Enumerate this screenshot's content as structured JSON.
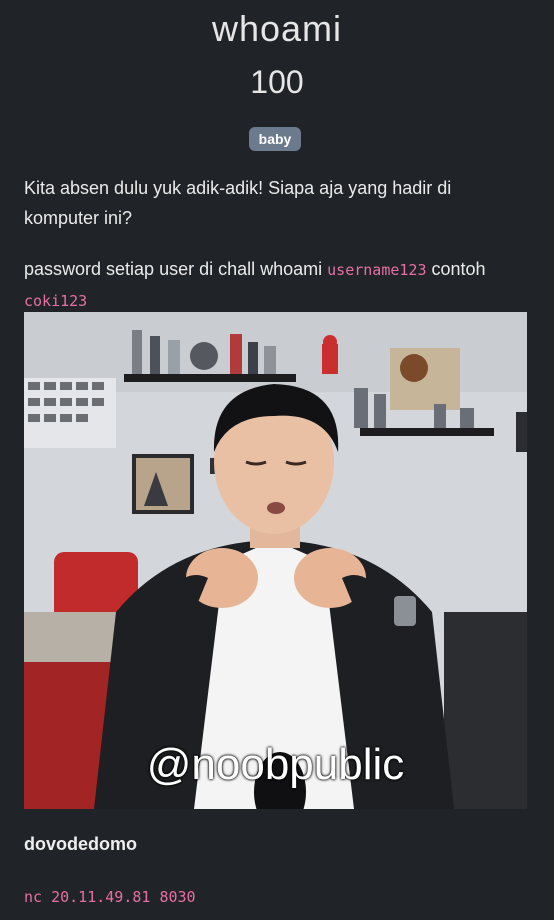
{
  "challenge": {
    "title": "whoami",
    "points": "100",
    "tag": "baby",
    "description_line1": "Kita absen dulu yuk adik-adik! Siapa aja yang hadir di komputer ini?",
    "description_line2_prefix": "password setiap user di chall whoami ",
    "password_format": "username123",
    "description_line2_middle": " contoh",
    "password_example": "coki123",
    "image_caption_text": "@noobpublic",
    "author": "dovodedomo",
    "connection": "nc 20.11.49.81 8030"
  },
  "colors": {
    "background": "#202428",
    "badge": "#6c7a8d",
    "code": "#e76fa4"
  }
}
